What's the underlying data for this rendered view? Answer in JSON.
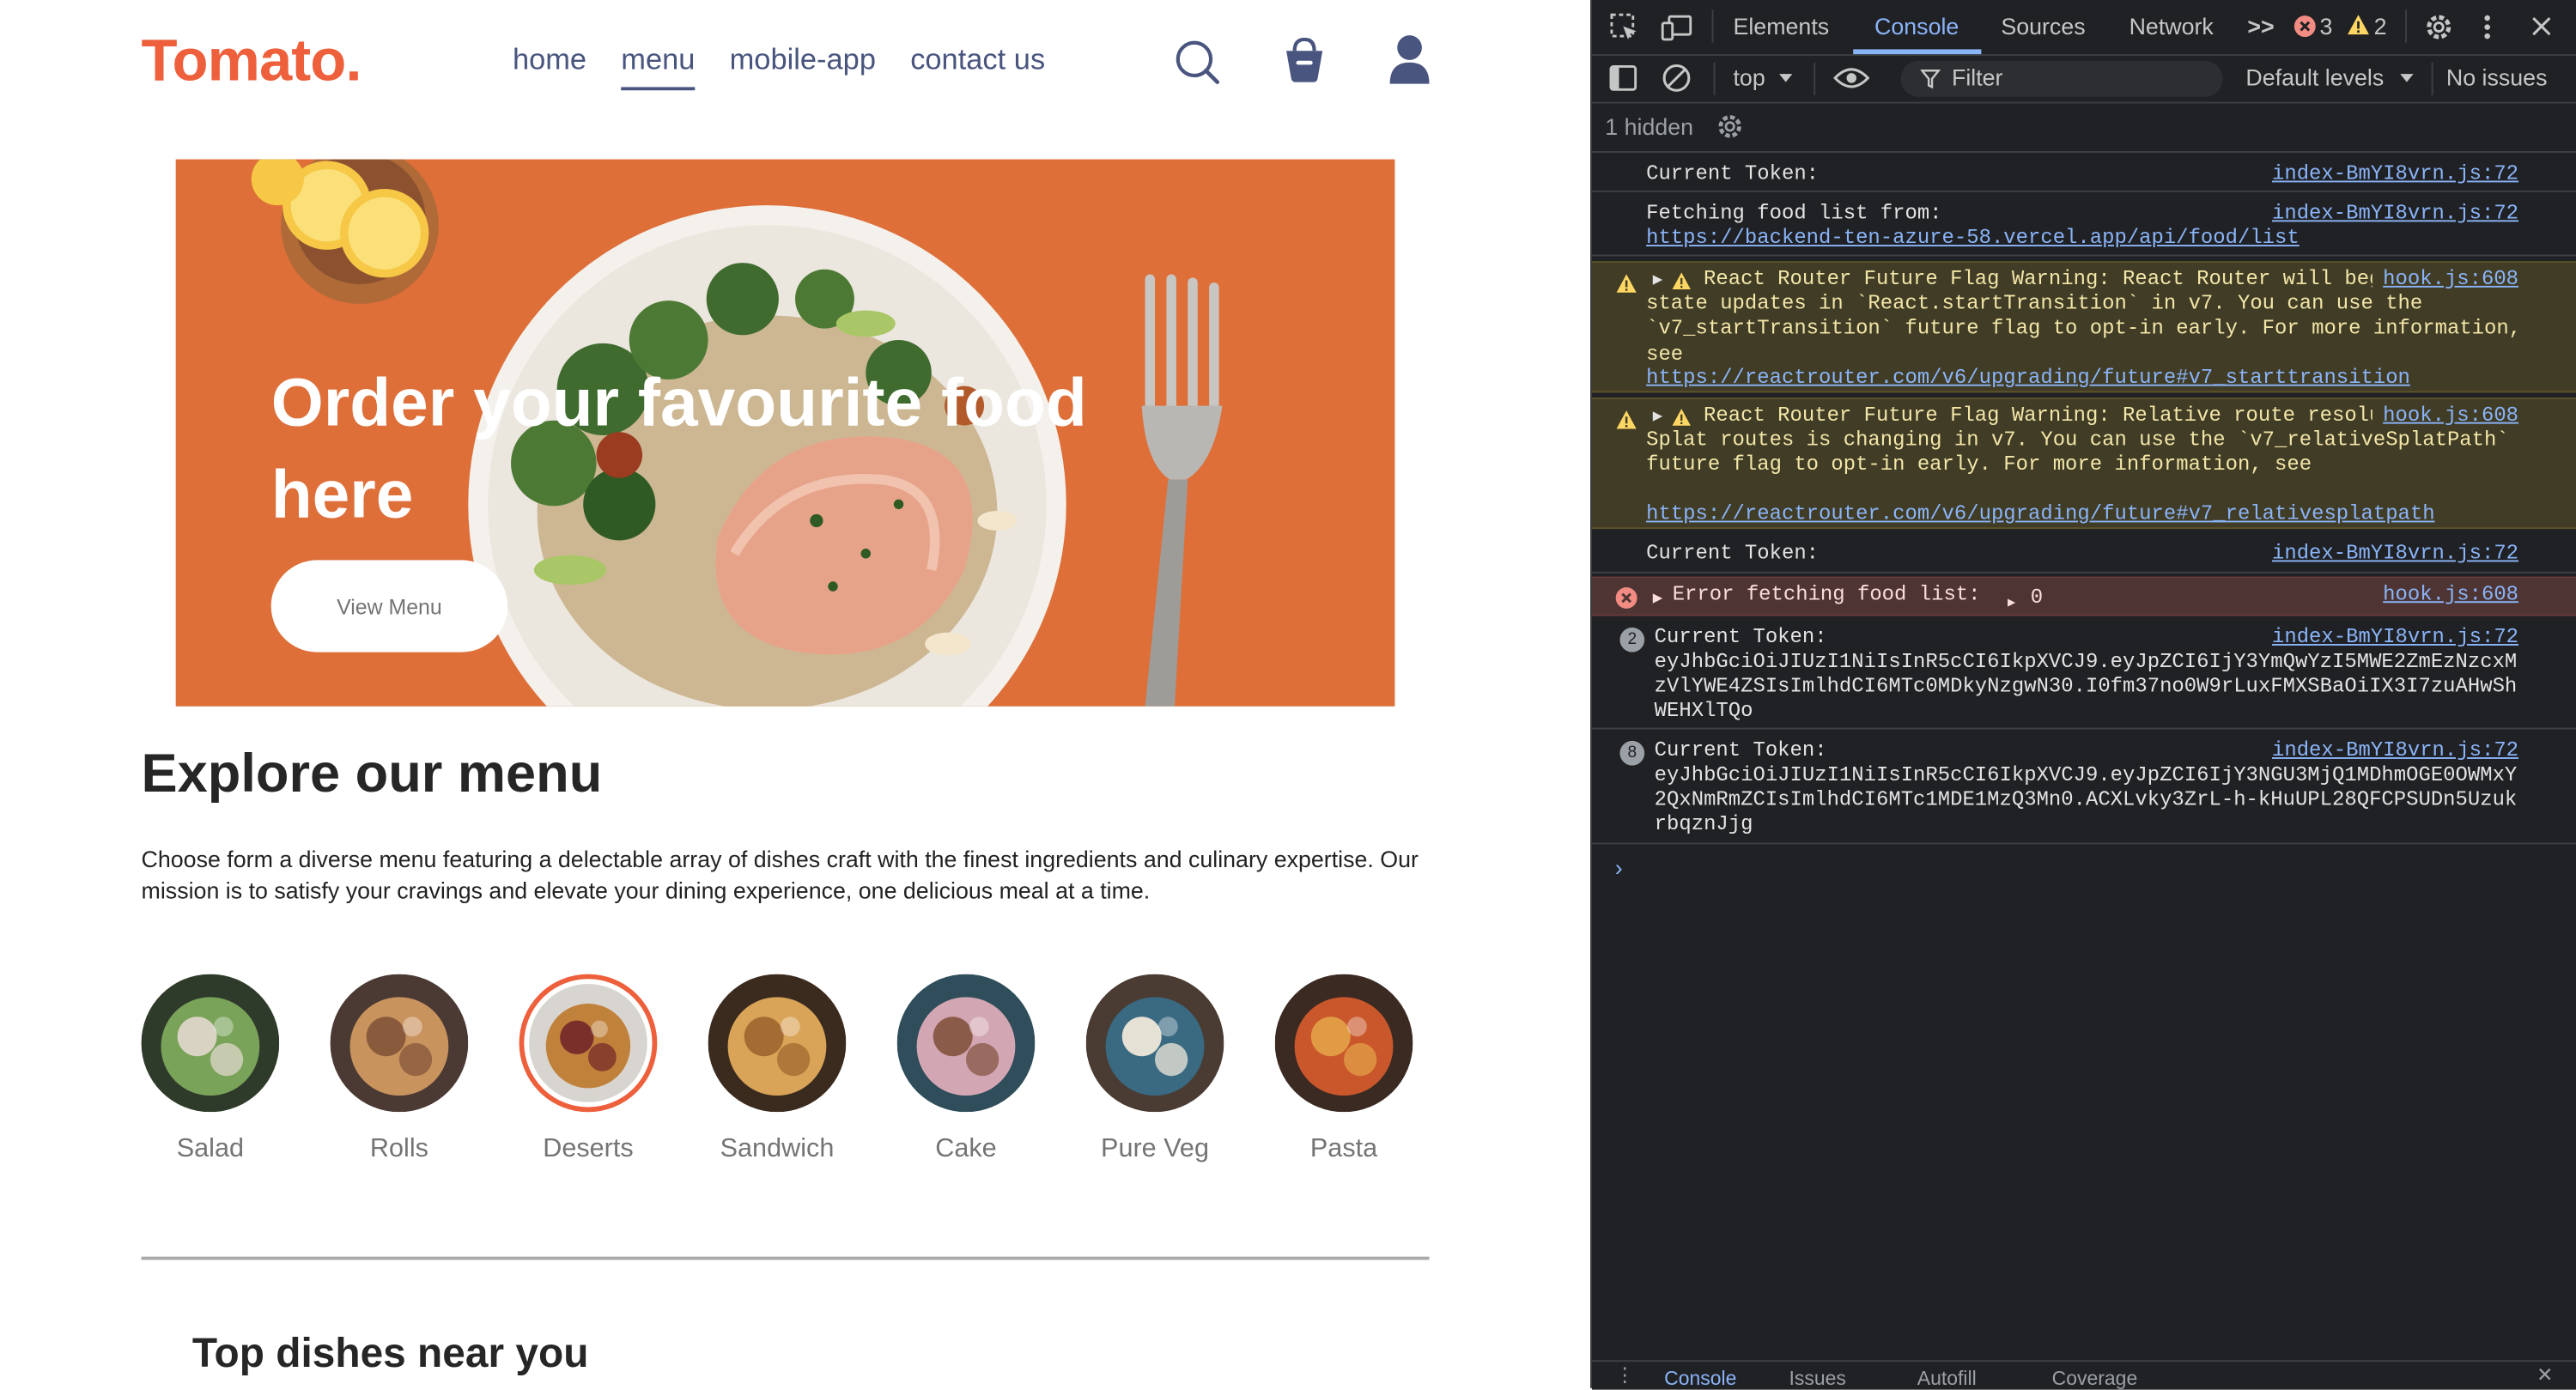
{
  "page": {
    "logo": "Tomato.",
    "nav": [
      "home",
      "menu",
      "mobile-app",
      "contact us"
    ],
    "nav_active": "menu",
    "hero": {
      "title": "Order your favourite food here",
      "button": "View Menu"
    },
    "explore": {
      "title": "Explore our menu",
      "text": "Choose form a diverse menu featuring a delectable array of dishes craft with the finest ingredients and culinary expertise. Our mission is to satisfy your cravings and elevate your dining experience, one delicious meal at a time."
    },
    "menu_items": [
      {
        "label": "Salad",
        "colors": [
          "#2e3a2a",
          "#7aa35a",
          "#d9d3c4"
        ],
        "active": false
      },
      {
        "label": "Rolls",
        "colors": [
          "#4a3a33",
          "#c9935e",
          "#8a5a3c"
        ],
        "active": false
      },
      {
        "label": "Deserts",
        "colors": [
          "#d8d4cf",
          "#c0813b",
          "#7a2f2b"
        ],
        "active": true
      },
      {
        "label": "Sandwich",
        "colors": [
          "#3b2a1e",
          "#d9a457",
          "#a46b32"
        ],
        "active": false
      },
      {
        "label": "Cake",
        "colors": [
          "#2f4d5a",
          "#d3a6b3",
          "#8b5b4a"
        ],
        "active": false
      },
      {
        "label": "Pure Veg",
        "colors": [
          "#4a3b33",
          "#3a6a82",
          "#e5e1d5"
        ],
        "active": false
      },
      {
        "label": "Pasta",
        "colors": [
          "#3a2a22",
          "#c9572b",
          "#e29b45"
        ],
        "active": false
      }
    ],
    "top_dishes_title": "Top dishes near you"
  },
  "devtools": {
    "tabs": [
      "Elements",
      "Console",
      "Sources",
      "Network"
    ],
    "active_tab": "Console",
    "more_tabs": ">>",
    "error_count": "3",
    "warning_count": "2",
    "context": "top",
    "filter_placeholder": "Filter",
    "levels": "Default levels",
    "issues": "No issues",
    "hidden": "1 hidden",
    "messages": [
      {
        "type": "log",
        "text": "Current Token:",
        "src": "index-BmYI8vrn.js:72"
      },
      {
        "type": "log",
        "text": "Fetching food list from:",
        "link": "https://backend-ten-azure-58.vercel.app/api/food/list",
        "src": "index-BmYI8vrn.js:72"
      },
      {
        "type": "warn",
        "text": "React Router Future Flag Warning: React Router will begin wrapping state updates in `React.startTransition` in v7. You can use the `v7_startTransition` future flag to opt-in early. For more information, see",
        "link": "https://reactrouter.com/v6/upgrading/future#v7_starttransition",
        "src": "hook.js:608"
      },
      {
        "type": "warn",
        "text": "React Router Future Flag Warning: Relative route resolution within Splat routes is changing in v7. You can use the `v7_relativeSplatPath` future flag to opt-in early. For more information, see",
        "link": "https://reactrouter.com/v6/upgrading/future#v7_relativesplatpath",
        "src": "hook.js:608"
      },
      {
        "type": "log",
        "text": "Current Token:",
        "src": "index-BmYI8vrn.js:72"
      },
      {
        "type": "error",
        "text": "Error fetching food list:",
        "value": "0",
        "src": "hook.js:608"
      },
      {
        "type": "log",
        "count": "2",
        "text": "Current Token:",
        "token": "eyJhbGciOiJIUzI1NiIsInR5cCI6IkpXVCJ9.eyJpZCI6IjY3YmQwYzI5MWE2ZmEzNzcxMzVlYWE4ZSIsImlhdCI6MTc0MDkyNzgwN30.I0fm37no0W9rLuxFMXSBaOiIX3I7zuAHwShWEHXlTQo",
        "src": "index-BmYI8vrn.js:72"
      },
      {
        "type": "log",
        "count": "8",
        "text": "Current Token:",
        "token": "eyJhbGciOiJIUzI1NiIsInR5cCI6IkpXVCJ9.eyJpZCI6IjY3NGU3MjQ1MDhmOGE0OWMxY2QxNmRmZCIsImlhdCI6MTc1MDE1MzQ3Mn0.ACXLvky3ZrL-h-kHuUPL28QFCPSUDn5UzukrbqznJjg",
        "src": "index-BmYI8vrn.js:72"
      }
    ],
    "drawer_tabs": [
      "Console",
      "Issues",
      "Autofill",
      "Coverage"
    ]
  }
}
